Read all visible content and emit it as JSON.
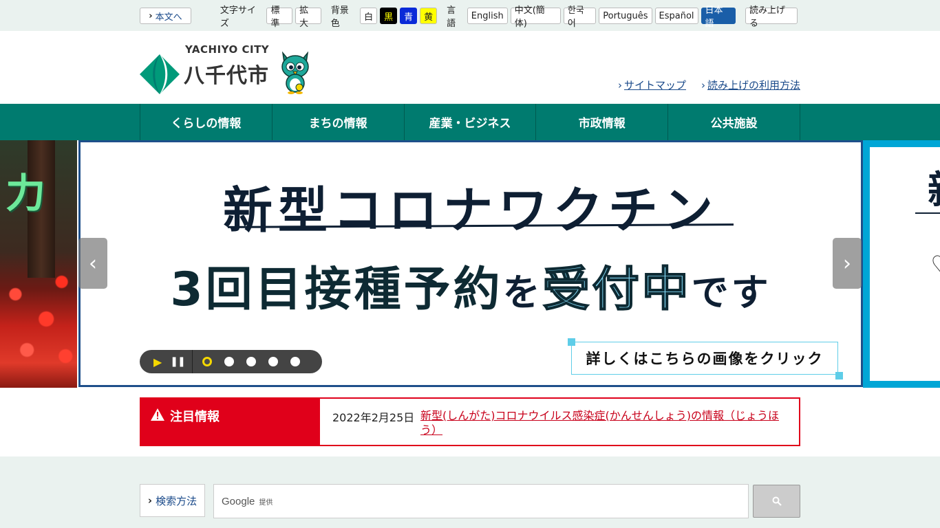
{
  "util": {
    "skip_label": "本文へ",
    "font_size_label": "文字サイズ",
    "font_standard": "標準",
    "font_large": "拡大",
    "bg_label": "背景色",
    "bg_white": "白",
    "bg_black": "黒",
    "bg_blue": "青",
    "bg_yellow": "黄",
    "lang_label": "言語",
    "languages": [
      "English",
      "中文(簡体)",
      "한국어",
      "Português",
      "Español",
      "日本語"
    ],
    "read_aloud": "読み上げる"
  },
  "header": {
    "logo_en": "YACHIYO CITY",
    "logo_jp": "八千代市",
    "sitemap": "サイトマップ",
    "read_howto": "読み上げの利用方法"
  },
  "nav": [
    "くらしの情報",
    "まちの情報",
    "産業・ビジネス",
    "市政情報",
    "公共施設"
  ],
  "slider": {
    "left_glyph": "力",
    "title": "新型コロナワクチン",
    "sub_a": "3回目接種予約",
    "sub_b": "を",
    "sub_c": "受付中",
    "sub_d": "です",
    "click_text": "詳しくはこちらの画像をクリック",
    "right_glyph": "新",
    "prev": "‹",
    "next": "›",
    "slide_count": 5,
    "active_slide": 1
  },
  "alert": {
    "heading": "注目情報",
    "date": "2022年2月25日",
    "link": "新型(しんがた)コロナウイルス感染症(かんせんしょう)の情報（じょうほう）"
  },
  "search": {
    "method": "検索方法",
    "brand": "Google",
    "brand_sub": "提供"
  },
  "colors": {
    "brand_green": "#007b6f",
    "alert_red": "#e0001a",
    "link_blue": "#1a4a8a"
  }
}
